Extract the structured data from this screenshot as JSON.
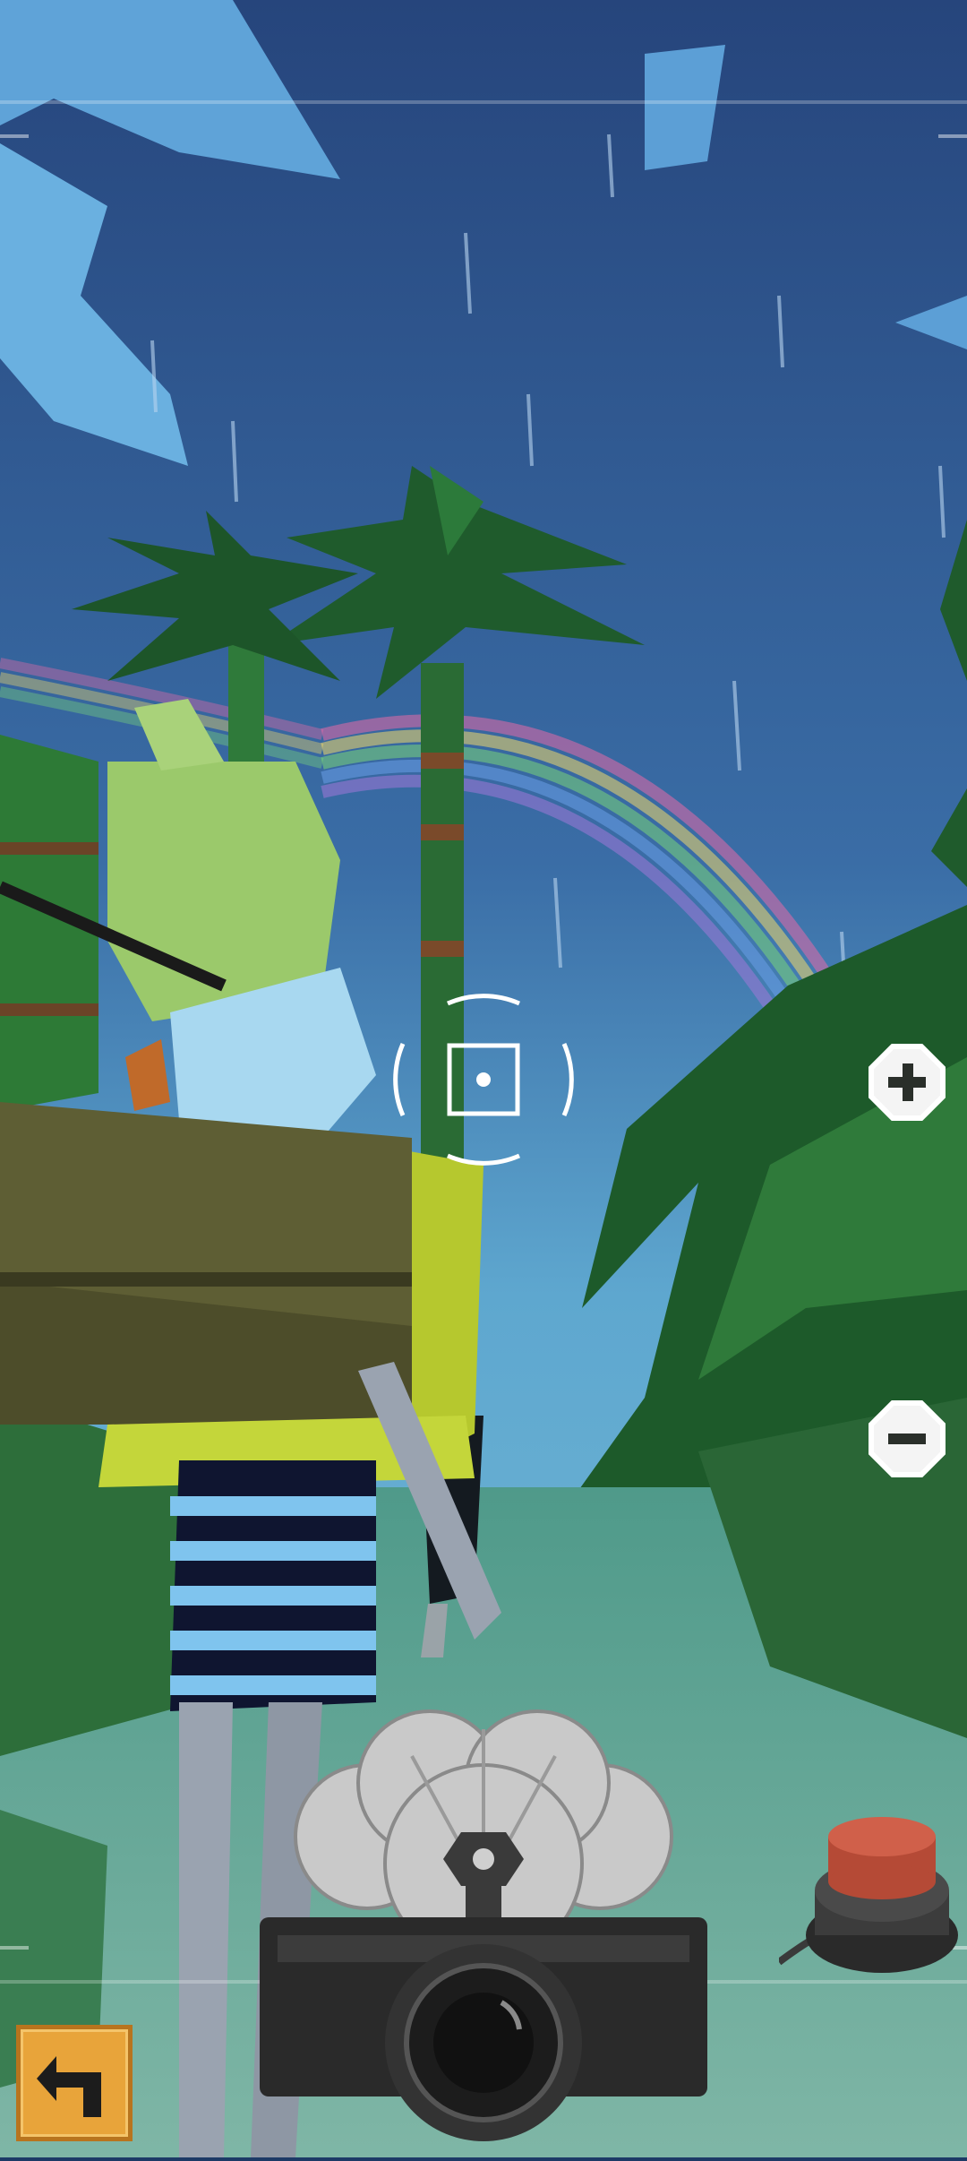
{
  "hud": {
    "zoom_in_icon": "plus-icon",
    "zoom_out_icon": "minus-icon",
    "back_icon": "return-arrow-icon",
    "shutter_icon": "camera-shutter-icon",
    "red_button_icon": "red-push-button-icon"
  },
  "colors": {
    "sky_top": "#2b4d86",
    "sky_bottom": "#5fa8cf",
    "foliage_dark": "#1f5b2c",
    "foliage_light": "#3f8f3a",
    "back_button": "#e8a43a",
    "red_button": "#d0604a"
  }
}
